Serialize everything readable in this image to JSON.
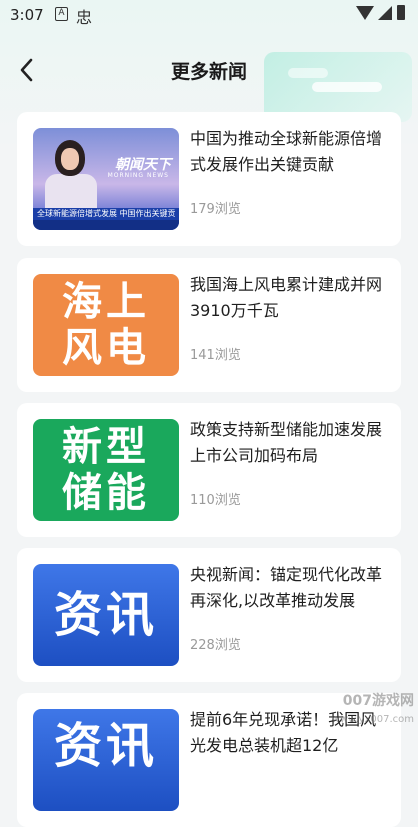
{
  "status": {
    "time": "3:07",
    "icons": [
      "a-notification-icon",
      "app-notification-icon",
      "wifi-icon",
      "signal-icon",
      "battery-icon"
    ]
  },
  "header": {
    "title": "更多新闻",
    "back_icon": "chevron-left-icon"
  },
  "news": [
    {
      "title": "中国为推动全球新能源倍增式发展作出关键贡献",
      "views": "179浏览",
      "thumb": {
        "type": "news-anchor",
        "logo": "朝闻天下",
        "logo_sub": "MORNING NEWS",
        "ticker": "全球新能源倍增式发展 中国作出关键贡"
      }
    },
    {
      "title": "我国海上风电累计建成并网3910万千瓦",
      "views": "141浏览",
      "thumb": {
        "type": "text",
        "lines": [
          "海上",
          "风电"
        ],
        "color": "#f08a45"
      }
    },
    {
      "title": "政策支持新型储能加速发展 上市公司加码布局",
      "views": "110浏览",
      "thumb": {
        "type": "text",
        "lines": [
          "新型",
          "储能"
        ],
        "color": "#1aa85c"
      }
    },
    {
      "title": "央视新闻：锚定现代化改革再深化,以改革推动发展",
      "views": "228浏览",
      "thumb": {
        "type": "text",
        "lines": [
          "资讯"
        ],
        "color": "#2f63d8"
      }
    },
    {
      "title": "提前6年兑现承诺！我国风光发电总装机超12亿",
      "views": "",
      "thumb": {
        "type": "text",
        "lines": [
          "资讯"
        ],
        "color": "#2f63d8"
      }
    }
  ],
  "watermark": {
    "line1": "007游戏网",
    "line2": "www.yx007.com"
  }
}
